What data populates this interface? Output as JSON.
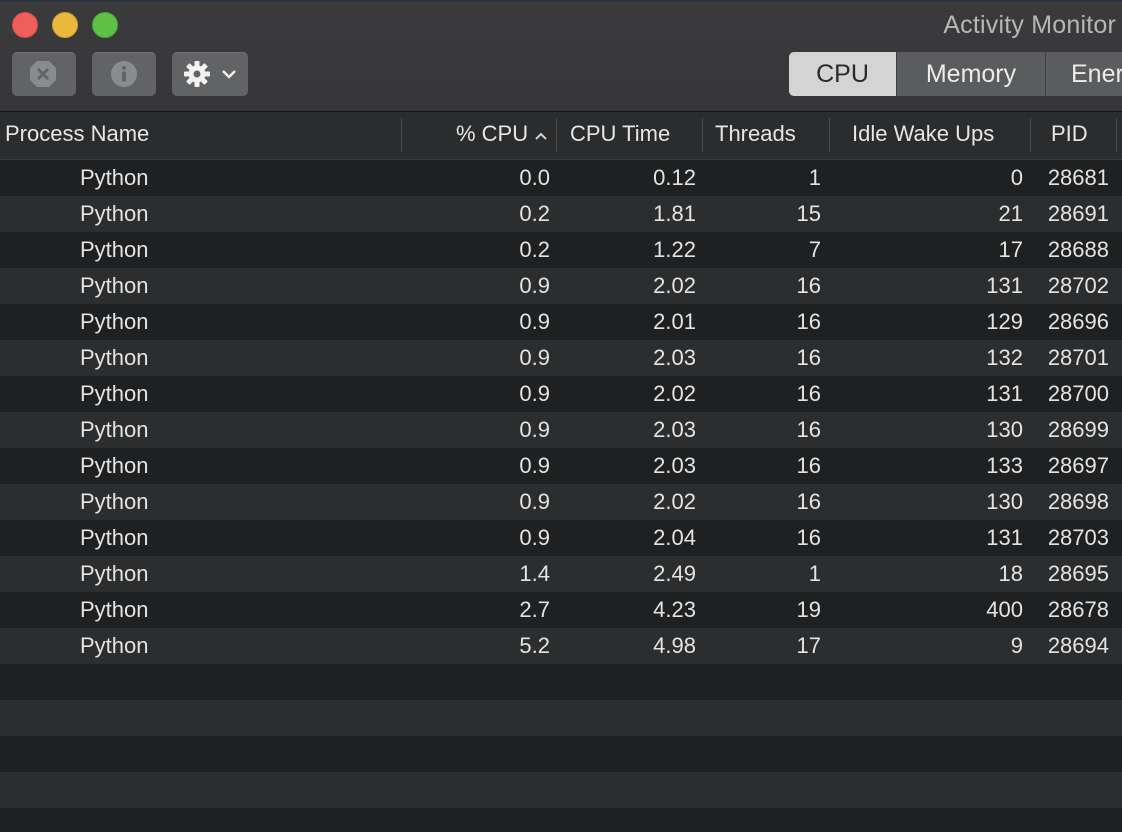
{
  "window": {
    "title": "Activity Monitor"
  },
  "toolbar": {
    "stop_icon": "stop-process-icon",
    "info_icon": "info-icon",
    "gear_icon": "gear-icon",
    "tabs": [
      {
        "label": "CPU",
        "selected": true
      },
      {
        "label": "Memory",
        "selected": false
      },
      {
        "label": "Ener",
        "selected": false
      }
    ]
  },
  "table": {
    "columns": {
      "process_name": "Process Name",
      "cpu_percent": "% CPU",
      "cpu_time": "CPU Time",
      "threads": "Threads",
      "idle_wake_ups": "Idle Wake Ups",
      "pid": "PID"
    },
    "sort": {
      "column": "cpu_percent",
      "direction": "ascending"
    },
    "rows": [
      {
        "name": "Python",
        "cpu": "0.0",
        "time": "0.12",
        "threads": "1",
        "idle": "0",
        "pid": "28681"
      },
      {
        "name": "Python",
        "cpu": "0.2",
        "time": "1.81",
        "threads": "15",
        "idle": "21",
        "pid": "28691"
      },
      {
        "name": "Python",
        "cpu": "0.2",
        "time": "1.22",
        "threads": "7",
        "idle": "17",
        "pid": "28688"
      },
      {
        "name": "Python",
        "cpu": "0.9",
        "time": "2.02",
        "threads": "16",
        "idle": "131",
        "pid": "28702"
      },
      {
        "name": "Python",
        "cpu": "0.9",
        "time": "2.01",
        "threads": "16",
        "idle": "129",
        "pid": "28696"
      },
      {
        "name": "Python",
        "cpu": "0.9",
        "time": "2.03",
        "threads": "16",
        "idle": "132",
        "pid": "28701"
      },
      {
        "name": "Python",
        "cpu": "0.9",
        "time": "2.02",
        "threads": "16",
        "idle": "131",
        "pid": "28700"
      },
      {
        "name": "Python",
        "cpu": "0.9",
        "time": "2.03",
        "threads": "16",
        "idle": "130",
        "pid": "28699"
      },
      {
        "name": "Python",
        "cpu": "0.9",
        "time": "2.03",
        "threads": "16",
        "idle": "133",
        "pid": "28697"
      },
      {
        "name": "Python",
        "cpu": "0.9",
        "time": "2.02",
        "threads": "16",
        "idle": "130",
        "pid": "28698"
      },
      {
        "name": "Python",
        "cpu": "0.9",
        "time": "2.04",
        "threads": "16",
        "idle": "131",
        "pid": "28703"
      },
      {
        "name": "Python",
        "cpu": "1.4",
        "time": "2.49",
        "threads": "1",
        "idle": "18",
        "pid": "28695"
      },
      {
        "name": "Python",
        "cpu": "2.7",
        "time": "4.23",
        "threads": "19",
        "idle": "400",
        "pid": "28678"
      },
      {
        "name": "Python",
        "cpu": "5.2",
        "time": "4.98",
        "threads": "17",
        "idle": "9",
        "pid": "28694"
      }
    ]
  },
  "colors": {
    "close": "#ed5f58",
    "minimize": "#e9b83d",
    "maximize": "#5ec146",
    "row_even": "#1f2021",
    "row_odd": "#2c2d2e"
  }
}
